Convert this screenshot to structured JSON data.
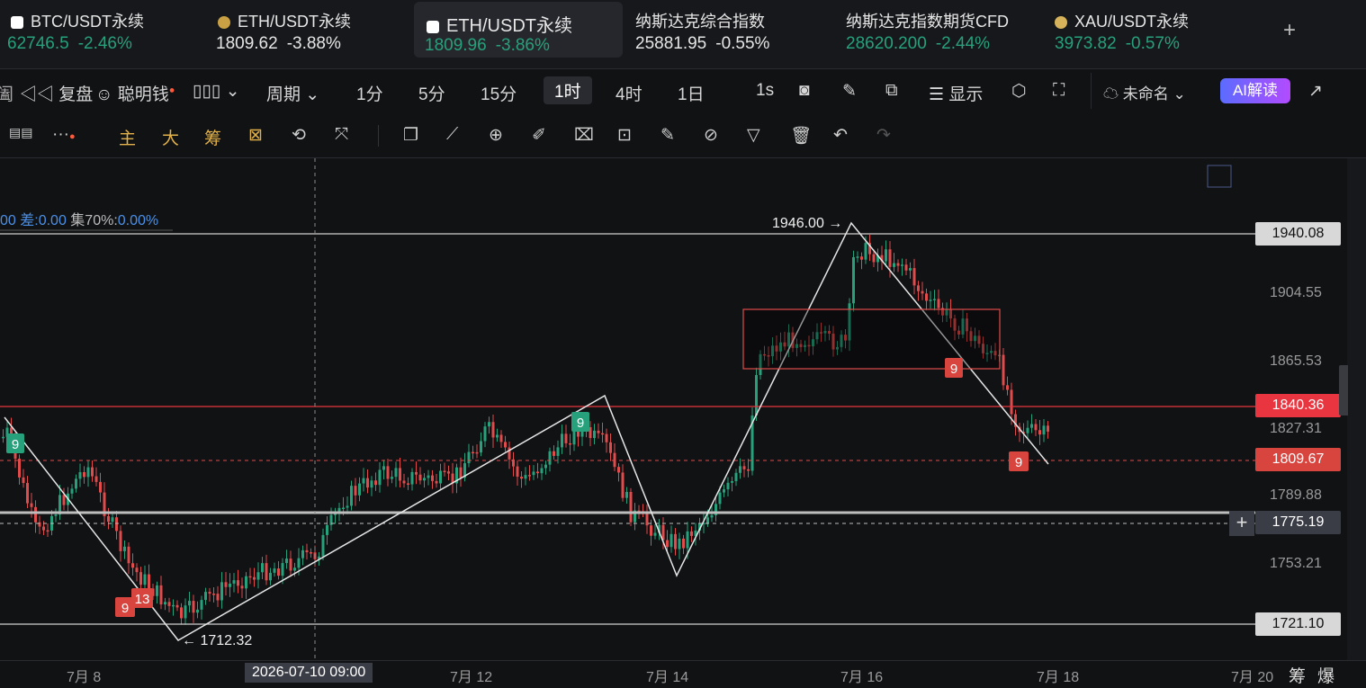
{
  "tickers": [
    {
      "name": "BTC/USDT永续",
      "price": "62746.5",
      "change": "-2.46%",
      "icon": "x-logo-icon"
    },
    {
      "name": "ETH/USDT永续",
      "price": "1809.62",
      "change": "-3.88%",
      "icon": "eth-coin-icon"
    },
    {
      "name": "ETH/USDT永续",
      "price": "1809.96",
      "change": "-3.86%",
      "icon": "x-logo-icon"
    },
    {
      "name": "纳斯达克综合指数",
      "price": "25881.95",
      "change": "-0.55%"
    },
    {
      "name": "纳斯达克指数期货CFD",
      "price": "28620.200",
      "change": "-2.44%"
    },
    {
      "name": "XAU/USDT永续",
      "price": "3973.82",
      "change": "-0.57%",
      "icon": "gold-coin-icon"
    }
  ],
  "toolbar": {
    "replay": "复盘",
    "smart_money": "聪明钱",
    "period": "周期",
    "intervals": [
      "1分",
      "5分",
      "15分",
      "1时",
      "4时",
      "1日"
    ],
    "active_interval": "1时",
    "seconds": "1s",
    "display": "显示",
    "layout_name": "未命名",
    "ai": "AI解读"
  },
  "drawbar": {
    "main": "主",
    "big": "大",
    "chip": "筹"
  },
  "chart": {
    "info_a": "00",
    "diff_label": "差:",
    "diff_value": "0.00",
    "conc_label": "集70%:",
    "conc_value": "0.00%",
    "high_label": "1946.00",
    "low_label": "1712.32",
    "td_marks": [
      "9",
      "9",
      "13",
      "9",
      "9",
      "9"
    ],
    "crosshair_date": "2026-07-10 09:00",
    "y_ticks": [
      "1940.08",
      "1904.55",
      "1865.53",
      "1840.36",
      "1827.31",
      "1809.67",
      "1789.88",
      "1775.19",
      "1753.21",
      "1721.10"
    ],
    "x_ticks": [
      "7月 8",
      "7月 12",
      "7月 14",
      "7月 16",
      "7月 18",
      "7月 20"
    ],
    "footer_a": "筹",
    "footer_b": "爆"
  },
  "colors": {
    "up": "#26a17b",
    "down": "#e04b4b",
    "accent": "#e8353f",
    "gold": "#e2b14a"
  }
}
